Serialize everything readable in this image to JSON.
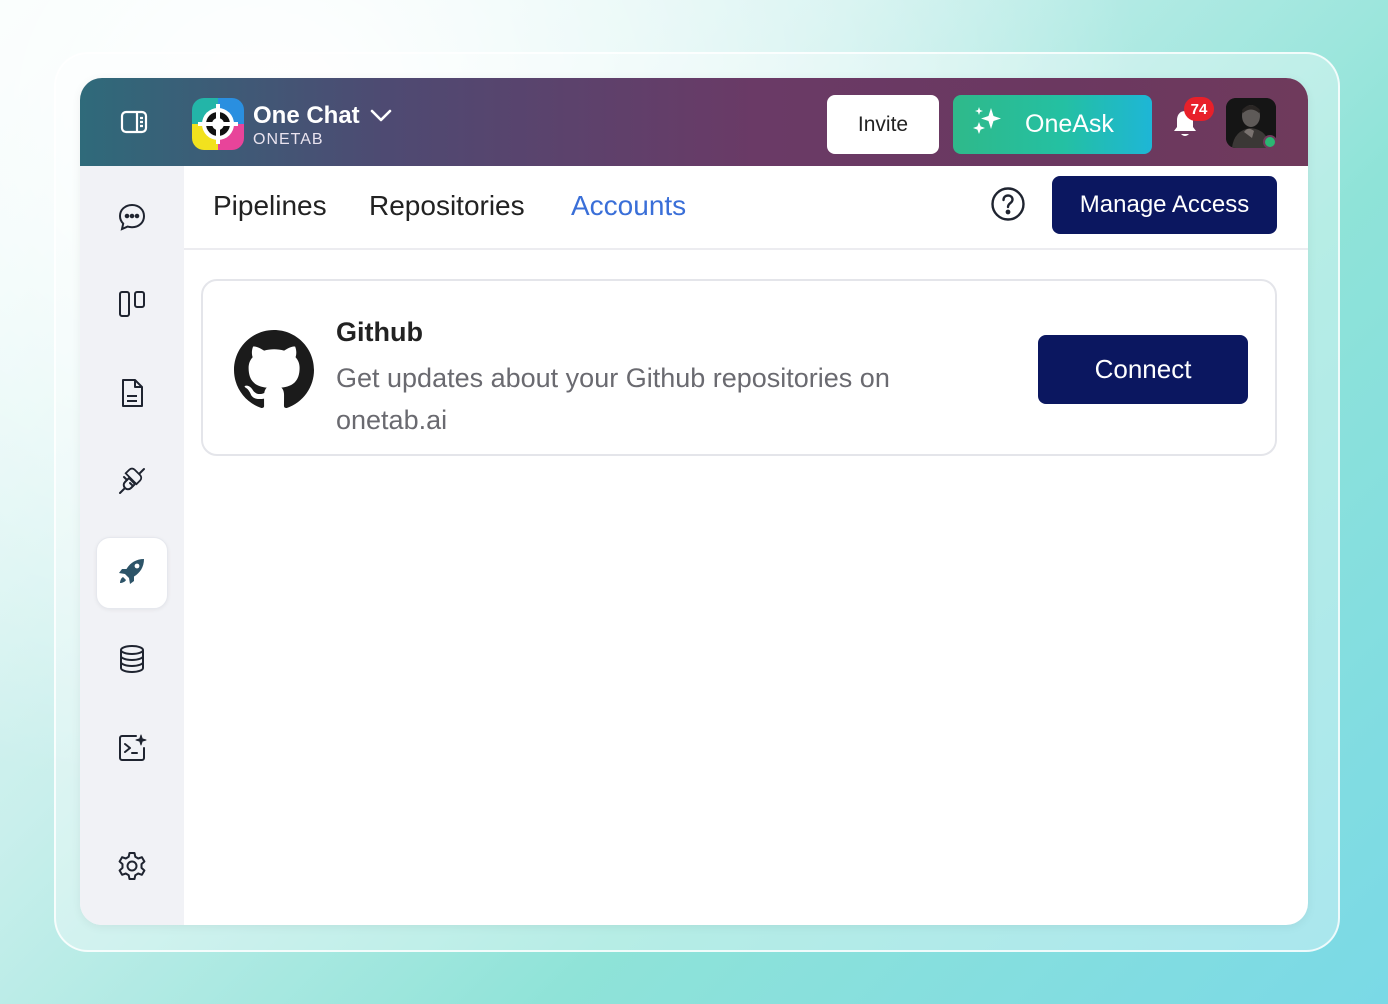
{
  "header": {
    "app_name": "One Chat",
    "app_sub": "ONETAB",
    "invite_label": "Invite",
    "oneask_label": "OneAsk",
    "notification_count": "74"
  },
  "sidebar": {
    "items": [
      {
        "icon": "chat-bubble-icon"
      },
      {
        "icon": "columns-icon"
      },
      {
        "icon": "document-icon"
      },
      {
        "icon": "plug-icon"
      },
      {
        "icon": "rocket-icon",
        "active": true
      },
      {
        "icon": "database-icon"
      },
      {
        "icon": "terminal-sparkle-icon"
      },
      {
        "icon": "gear-icon"
      }
    ]
  },
  "tabs": [
    {
      "label": "Pipelines",
      "active": false
    },
    {
      "label": "Repositories",
      "active": false
    },
    {
      "label": "Accounts",
      "active": true
    }
  ],
  "toolbar": {
    "manage_access_label": "Manage Access"
  },
  "accounts": [
    {
      "title": "Github",
      "description": "Get updates about your Github repositories on onetab.ai",
      "button_label": "Connect"
    }
  ],
  "colors": {
    "accent_tab": "#3a6fd8",
    "primary_button": "#0b1760",
    "badge": "#e8202a",
    "online": "#2bb673"
  }
}
